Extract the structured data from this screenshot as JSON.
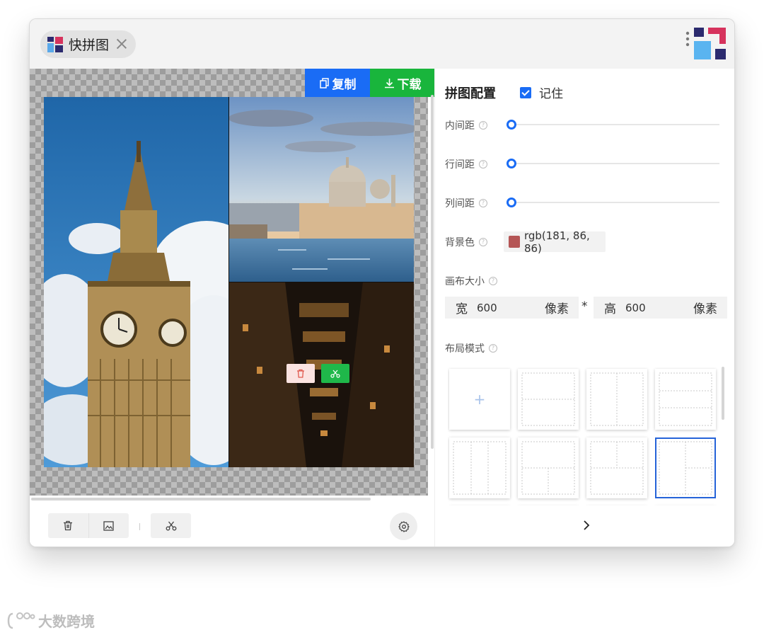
{
  "tab": {
    "title": "快拼图",
    "close_icon": "close-icon"
  },
  "actions": {
    "copy_label": "复制",
    "download_label": "下载"
  },
  "panel": {
    "title": "拼图配置",
    "remember_label": "记住",
    "remember_checked": true,
    "padding_label": "内间距",
    "row_gap_label": "行间距",
    "col_gap_label": "列间距",
    "bg_label": "背景色",
    "bg_value": "rgb(181, 86, 86)",
    "bg_color": "#b55656",
    "canvas_size_label": "画布大小",
    "width_key": "宽",
    "width_value": "600",
    "height_key": "高",
    "height_value": "600",
    "unit": "像素",
    "times": "*",
    "layout_label": "布局模式",
    "add_layout": "+",
    "selected_layout_index": 7
  },
  "colors": {
    "accent": "#1a6cf5",
    "download": "#19b53c",
    "delete_bg": "#fbe3e1"
  },
  "watermark": "大数跨境"
}
